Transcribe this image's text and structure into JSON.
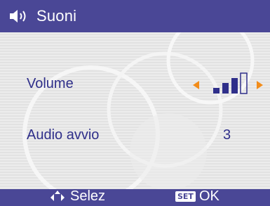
{
  "header": {
    "icon": "speaker-icon",
    "title": "Suoni"
  },
  "settings": {
    "volume": {
      "label": "Volume",
      "level": 3,
      "max_level": 4
    },
    "audio_avvio": {
      "label": "Audio avvio",
      "value": "3"
    }
  },
  "footer": {
    "nav_icon": "up-down-arrows-icon",
    "nav_label": "Selez",
    "set_badge": "SET",
    "ok_label": "OK"
  },
  "colors": {
    "header_bg": "#4a4796",
    "text": "#2f2f8a",
    "accent": "#f28c1a"
  }
}
